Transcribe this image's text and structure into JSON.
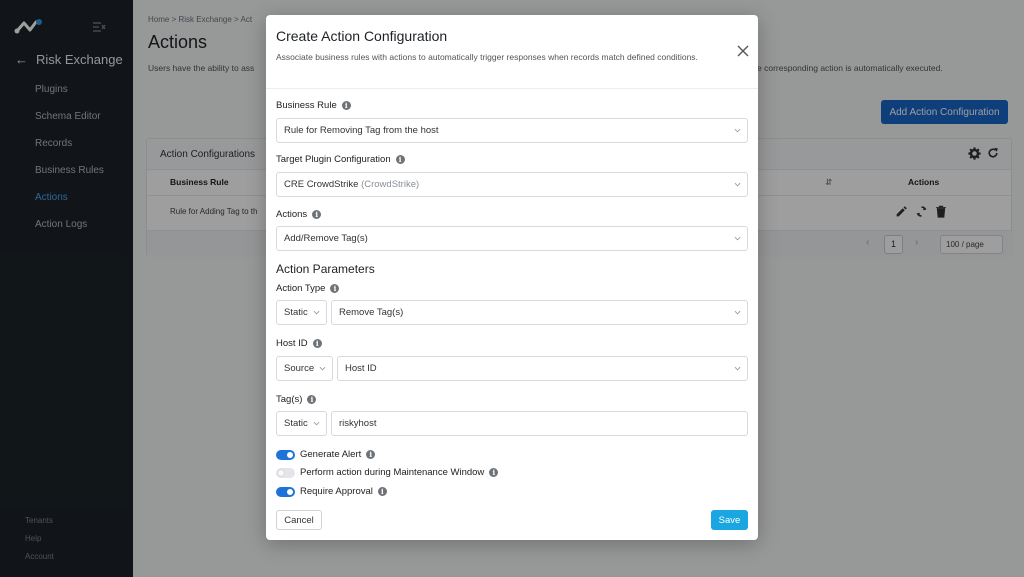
{
  "sidebar": {
    "back_label": "Risk Exchange",
    "items": [
      {
        "label": "Plugins"
      },
      {
        "label": "Schema Editor"
      },
      {
        "label": "Records"
      },
      {
        "label": "Business Rules"
      },
      {
        "label": "Actions",
        "active": true
      },
      {
        "label": "Action Logs"
      }
    ],
    "footer": [
      "Tenants",
      "Help",
      "Account"
    ]
  },
  "main": {
    "breadcrumb": "Home  >  Risk Exchange  >  Act",
    "title": "Actions",
    "description_left": "Users have the ability to ass",
    "description_right": "e corresponding action is automatically executed.",
    "add_button": "Add Action Configuration",
    "card_title": "Action Configurations",
    "columns": {
      "business_rule": "Business Rule",
      "actions": "Actions"
    },
    "row_business_rule": "Rule for Adding Tag to th",
    "page": "1",
    "per_page": "100 / page"
  },
  "modal": {
    "title": "Create Action Configuration",
    "subtitle": "Associate business rules with actions to automatically trigger responses when records match defined conditions.",
    "business_rule": {
      "label": "Business Rule",
      "value": "Rule for Removing Tag from the host"
    },
    "target_plugin": {
      "label": "Target Plugin Configuration",
      "value": "CRE CrowdStrike",
      "value_suffix": "(CrowdStrike)"
    },
    "actions": {
      "label": "Actions",
      "value": "Add/Remove Tag(s)"
    },
    "params_title": "Action Parameters",
    "action_type": {
      "label": "Action Type",
      "mode": "Static",
      "value": "Remove Tag(s)"
    },
    "host_id": {
      "label": "Host ID",
      "mode": "Source",
      "value": "Host ID"
    },
    "tags": {
      "label": "Tag(s)",
      "mode": "Static",
      "value": "riskyhost"
    },
    "toggles": [
      {
        "label": "Generate Alert",
        "on": true
      },
      {
        "label": "Perform action during Maintenance Window",
        "on": false
      },
      {
        "label": "Require Approval",
        "on": true
      }
    ],
    "cancel": "Cancel",
    "save": "Save"
  },
  "colors": {
    "accent": "#1e73d8",
    "save": "#1aa6e0",
    "sidebar": "#1c2329",
    "active_nav": "#4aa9ef"
  },
  "icons": [
    "logo-icon",
    "collapse-icon",
    "back-arrow-icon",
    "gear-icon",
    "refresh-icon",
    "edit-icon",
    "sync-icon",
    "delete-icon",
    "close-icon",
    "info-icon",
    "chevron-down-icon"
  ]
}
